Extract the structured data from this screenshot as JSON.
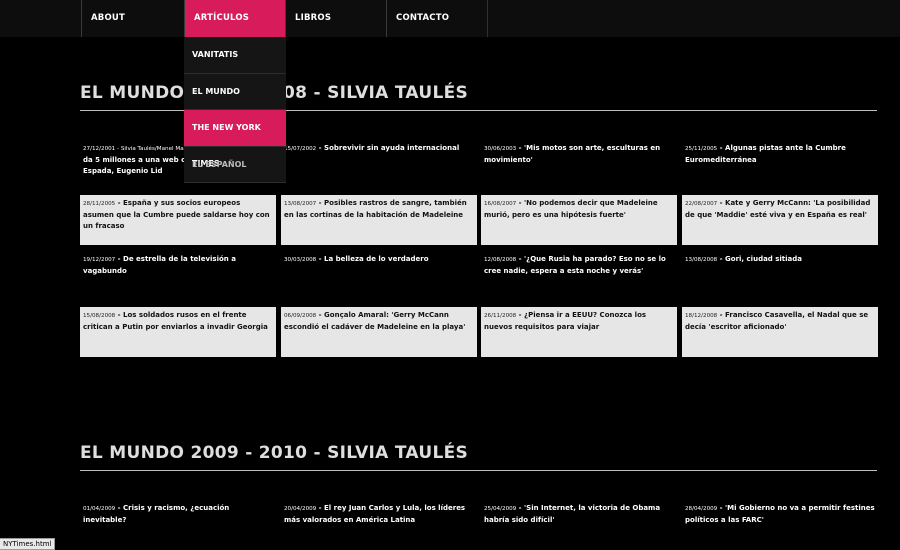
{
  "nav": {
    "items": [
      {
        "label": "ABOUT"
      },
      {
        "label": "ARTÍCULOS"
      },
      {
        "label": "LIBROS"
      },
      {
        "label": "CONTACTO"
      }
    ],
    "dropdown": [
      {
        "label": "VANITATIS"
      },
      {
        "label": "EL MUNDO"
      },
      {
        "label": "THE NEW YORK TIMES"
      },
      {
        "label": "EL ESPAÑOL"
      }
    ]
  },
  "section1": {
    "title": "EL MUNDO 2001 - 2008 - SILVIA TAULÉS",
    "articles": [
      {
        "date": "27/12/2001 - Silvia Taulés/Manel Manchón",
        "title": " - La Generalitat da 5 millones a una web cristiana de Arcadi Espada, Eugenio Lid"
      },
      {
        "date": "15/07/2002",
        "title": " - Sobrevivir sin ayuda internacional"
      },
      {
        "date": "30/06/2003",
        "title": " - 'Mis motos son arte, esculturas en movimiento'"
      },
      {
        "date": "25/11/2005",
        "title": " - Algunas pistas ante la Cumbre Euromediterránea"
      },
      {
        "date": "28/11/2005",
        "title": " - España y sus socios europeos asumen que la Cumbre puede saldarse hoy con un fracaso"
      },
      {
        "date": "13/08/2007",
        "title": " - Posibles rastros de sangre, también en las cortinas de la habitación de Madeleine"
      },
      {
        "date": "16/08/2007",
        "title": " - 'No podemos decir que Madeleine murió, pero es una hipótesis fuerte'"
      },
      {
        "date": "22/08/2007",
        "title": " - Kate y Gerry McCann: 'La posibilidad de que 'Maddie' esté viva y en España es real'"
      },
      {
        "date": "19/12/2007",
        "title": " - De estrella de la televisión a vagabundo"
      },
      {
        "date": "30/03/2008",
        "title": " - La belleza de lo verdadero"
      },
      {
        "date": "12/08/2008",
        "title": " - '¿Que Rusia ha parado? Eso no se lo cree nadie, espera a esta noche y verás'"
      },
      {
        "date": "13/08/2008",
        "title": " - Gori, ciudad sitiada"
      },
      {
        "date": "15/08/2008",
        "title": " - Los soldados rusos en el frente critican a Putin por enviarlos a invadir Georgia"
      },
      {
        "date": "06/09/2008",
        "title": " - Gonçalo Amaral: 'Gerry McCann escondió el cadáver de Madeleine en la playa'"
      },
      {
        "date": "26/11/2008",
        "title": " - ¿Piensa ir a EEUU? Conozca los nuevos requisitos para viajar"
      },
      {
        "date": "18/12/2008",
        "title": " - Francisco Casavella, el Nadal que se decía 'escritor aficionado'"
      }
    ]
  },
  "section2": {
    "title": "EL MUNDO 2009 - 2010 - SILVIA TAULÉS",
    "articles": [
      {
        "date": "01/04/2009",
        "title": " - Crisis y racismo, ¿ecuación inevitable?"
      },
      {
        "date": "20/04/2009",
        "title": " - El rey Juan Carlos y Lula, los líderes más valorados en América Latina"
      },
      {
        "date": "25/04/2009",
        "title": " - 'Sin Internet, la victoria de Obama habría sido difícil'"
      },
      {
        "date": "28/04/2009",
        "title": " - 'Mi Gobierno no va a permitir festines políticos a las FARC'"
      }
    ]
  },
  "status": {
    "url": "NYTimes.html"
  },
  "colors": {
    "accent": "#d81b5a",
    "background": "#000000",
    "card_light": "#e6e6e6"
  }
}
